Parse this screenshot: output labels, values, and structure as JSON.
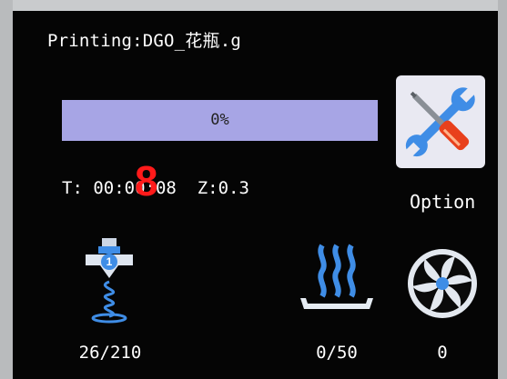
{
  "header": {
    "title": "Printing:DGO_花瓶.g"
  },
  "progress": {
    "label": "0%",
    "value": 0
  },
  "status": {
    "time": "T: 00:00:08",
    "z": "Z:0.3"
  },
  "overlay": {
    "digit": "8"
  },
  "option": {
    "label": "Option",
    "icon": "tools-icon"
  },
  "temps": {
    "extruder": {
      "value": "26/210",
      "icon": "nozzle-icon",
      "badge": "1"
    },
    "bed": {
      "value": "0/50",
      "icon": "heated-bed-icon"
    },
    "fan": {
      "value": "0",
      "icon": "fan-icon"
    }
  },
  "colors": {
    "progress_bar": "#a7a5e5",
    "accent_blue": "#3f8de6",
    "option_bg": "#e9e9f2",
    "overlay_digit": "#ff1a1a"
  }
}
